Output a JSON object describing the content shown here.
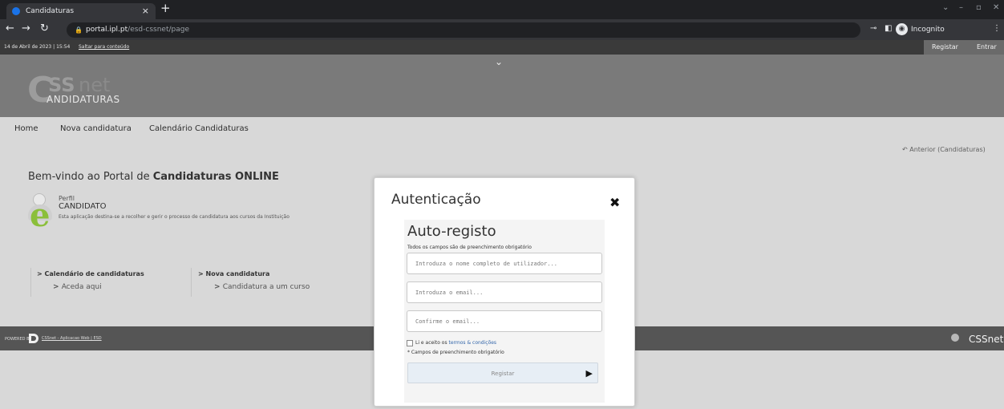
{
  "browser": {
    "tab_title": "Candidaturas",
    "tab_close": "×",
    "new_tab": "+",
    "url_host": "portal.ipl.pt",
    "url_path": "/esd-cssnet/page",
    "incognito_label": "Incognito"
  },
  "site": {
    "datetime": "14 de Abril de 2023 | 15:54",
    "skip_link": "Saltar para conteúdo",
    "register": "Registar",
    "login": "Entrar",
    "logo": {
      "c": "C",
      "ss": "SS",
      "net": "net",
      "sub": "ANDIDATURAS"
    },
    "nav": [
      "Home",
      "Nova candidatura",
      "Calendário Candidaturas"
    ],
    "back_link": "Anterior (Candidaturas)",
    "welcome_prefix": "Bem-vindo ao Portal de ",
    "welcome_bold": "Candidaturas ONLINE",
    "profile_label": "Perfil",
    "profile_role": "CANDIDATO",
    "profile_desc": "Esta aplicação destina-se a recolher e gerir o processo de candidatura aos cursos da Instituição",
    "quick_links": [
      {
        "title": "Calendário de candidaturas",
        "sub": "Aceda aqui"
      },
      {
        "title": "Nova candidatura",
        "sub": "Candidatura a um curso"
      }
    ],
    "footer": {
      "powered_by": "POWERED BY",
      "link": "CSSnet - Aplicacao Web | ESD",
      "brand": "CSSnet"
    }
  },
  "modal": {
    "title": "Autenticação",
    "close": "✖",
    "panel_title": "Auto-registo",
    "required_note": "Todos os campos são de preenchimento obrigatório",
    "fields": [
      {
        "placeholder": "Introduza o nome completo de utilizador..."
      },
      {
        "placeholder": "Introduza o email..."
      },
      {
        "placeholder": "Confirme o email..."
      }
    ],
    "terms_prefix": "Li e aceito os ",
    "terms_link": "termos & condições",
    "required_footer": "* Campos de preenchimento obrigatório",
    "submit": "Registar"
  }
}
